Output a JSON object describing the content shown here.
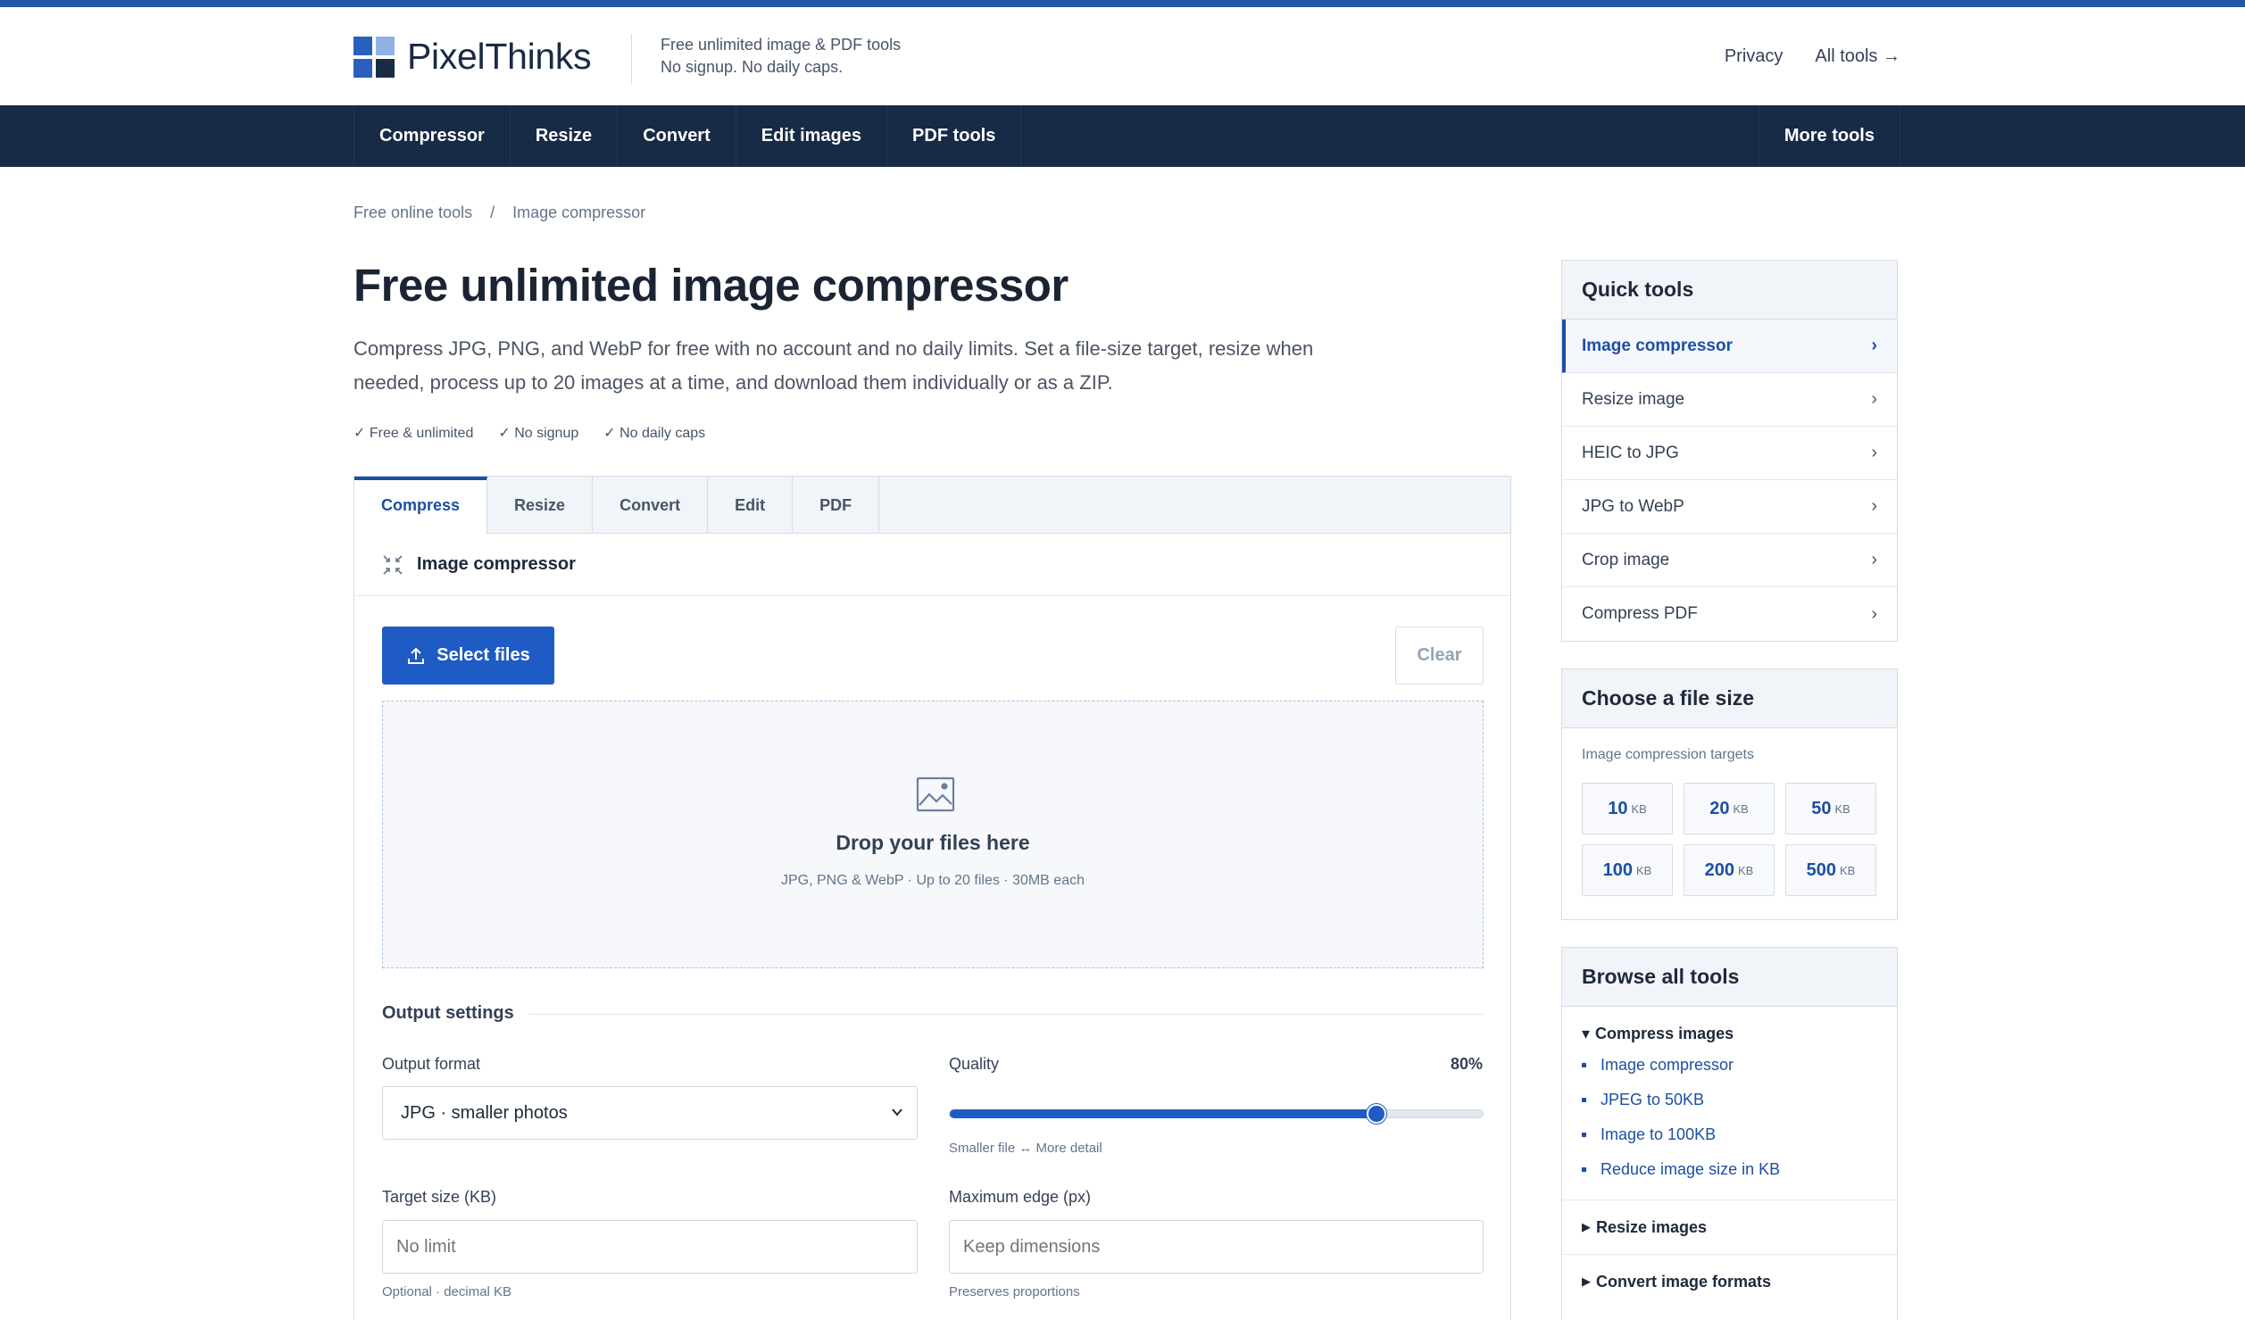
{
  "brand": {
    "name": "PixelThinks",
    "tagline_1": "Free unlimited image & PDF tools",
    "tagline_2": "No signup. No daily caps.",
    "colors": {
      "accent": "#1f5bc4",
      "nav": "#172a46"
    }
  },
  "header_links": {
    "privacy": "Privacy",
    "all_tools": "All tools →"
  },
  "nav": {
    "items": [
      "Compressor",
      "Resize",
      "Convert",
      "Edit images",
      "PDF tools"
    ],
    "more": "More tools"
  },
  "breadcrumb": {
    "root": "Free online tools",
    "separator": "/",
    "current": "Image compressor"
  },
  "page": {
    "title": "Free unlimited image compressor",
    "description": "Compress JPG, PNG, and WebP for free with no account and no daily limits. Set a file-size target, resize when needed, process up to 20 images at a time, and download them individually or as a ZIP.",
    "checks": [
      "✓ Free & unlimited",
      "✓ No signup",
      "✓ No daily caps"
    ]
  },
  "tool": {
    "tabs": [
      "Compress",
      "Resize",
      "Convert",
      "Edit",
      "PDF"
    ],
    "active_tab": "Compress",
    "heading": "Image compressor",
    "select_files": "Select files",
    "clear": "Clear",
    "dropzone": {
      "title": "Drop your files here",
      "subtitle": "JPG, PNG & WebP · Up to 20 files · 30MB each"
    },
    "output_settings": {
      "title": "Output settings",
      "format_label": "Output format",
      "format_value": "JPG · smaller photos",
      "quality_label": "Quality",
      "quality_value": "80%",
      "quality_fraction": 0.8,
      "quality_hint": "Smaller file ↔ More detail",
      "target_label": "Target size (KB)",
      "target_placeholder": "No limit",
      "target_hint": "Optional · decimal KB",
      "edge_label": "Maximum edge (px)",
      "edge_placeholder": "Keep dimensions",
      "edge_hint": "Preserves proportions"
    }
  },
  "sidebar": {
    "quick_tools": {
      "title": "Quick tools",
      "items": [
        "Image compressor",
        "Resize image",
        "HEIC to JPG",
        "JPG to WebP",
        "Crop image",
        "Compress PDF"
      ],
      "arrow": "›"
    },
    "file_size": {
      "title": "Choose a file size",
      "subtitle": "Image compression targets",
      "unit": "KB",
      "targets": [
        "10",
        "20",
        "50",
        "100",
        "200",
        "500"
      ]
    },
    "browse": {
      "title": "Browse all tools",
      "sections": [
        {
          "title": "Compress images",
          "expanded": true,
          "items": [
            "Image compressor",
            "JPEG to 50KB",
            "Image to 100KB",
            "Reduce image size in KB"
          ]
        },
        {
          "title": "Resize images",
          "expanded": false
        },
        {
          "title": "Convert image formats",
          "expanded": false
        }
      ]
    }
  }
}
